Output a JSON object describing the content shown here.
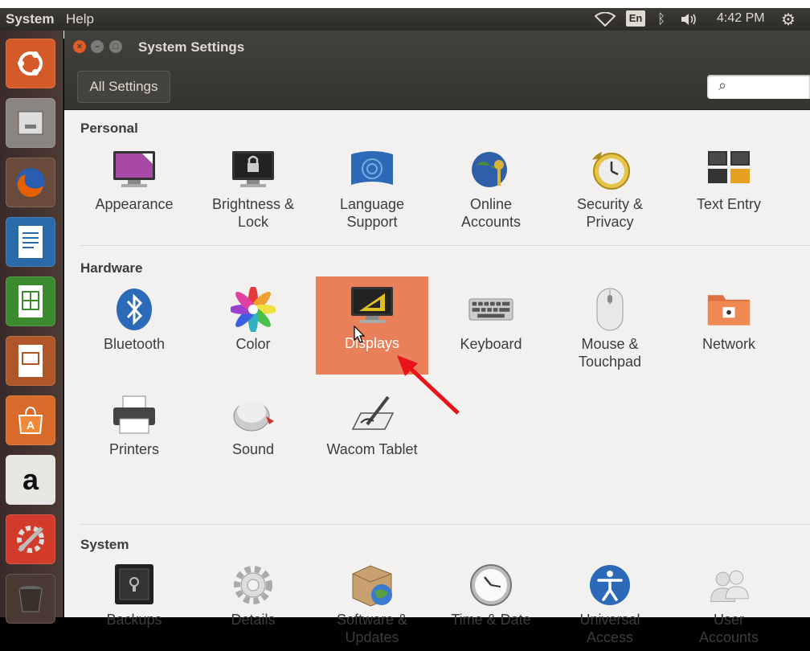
{
  "panel": {
    "menu_system": "System",
    "menu_help": "Help",
    "lang": "En",
    "time": "4:42 PM"
  },
  "window": {
    "title": "System Settings",
    "all_settings": "All Settings",
    "search_placeholder": ""
  },
  "sections": {
    "personal": {
      "title": "Personal",
      "items": [
        "Appearance",
        "Brightness &\nLock",
        "Language\nSupport",
        "Online\nAccounts",
        "Security &\nPrivacy",
        "Text Entry"
      ]
    },
    "hardware": {
      "title": "Hardware",
      "items": [
        "Bluetooth",
        "Color",
        "Displays",
        "Keyboard",
        "Mouse &\nTouchpad",
        "Network",
        "Printers",
        "Sound",
        "Wacom Tablet"
      ]
    },
    "system": {
      "title": "System",
      "items": [
        "Backups",
        "Details",
        "Software &\nUpdates",
        "Time & Date",
        "Universal\nAccess",
        "User\nAccounts"
      ]
    }
  },
  "selected_item": "Displays",
  "colors": {
    "accent": "#e9805a",
    "panel_bg": "#3c3b37",
    "launcher_bg": "#4c3a33"
  },
  "launcher_icons": [
    "ubuntu-dash-icon",
    "files-icon",
    "firefox-icon",
    "writer-icon",
    "calc-icon",
    "impress-icon",
    "software-center-icon",
    "amazon-icon",
    "system-settings-icon",
    "trash-icon"
  ]
}
